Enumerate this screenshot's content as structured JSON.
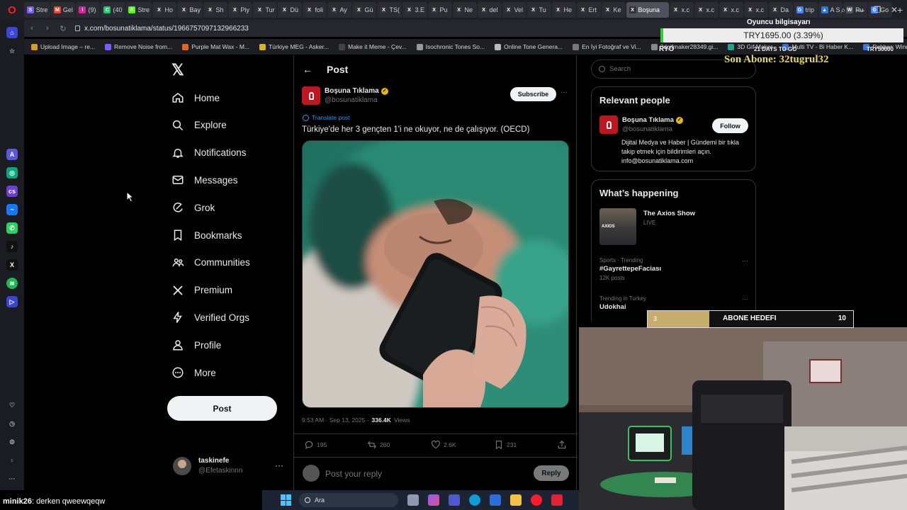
{
  "browser": {
    "tabs": [
      {
        "label": "Stre",
        "icon": "S",
        "color": "#7b5cff"
      },
      {
        "label": "Gel",
        "icon": "M",
        "color": "#ea4335"
      },
      {
        "label": "(9)",
        "icon": "I",
        "color": "#d6249f"
      },
      {
        "label": "(40",
        "icon": "C",
        "color": "#2fbf71"
      },
      {
        "label": "Stre",
        "icon": "K",
        "color": "#53fc18"
      },
      {
        "label": "Ho",
        "icon": "X",
        "color": "#333"
      },
      {
        "label": "Bay",
        "icon": "X",
        "color": "#333"
      },
      {
        "label": "Sh",
        "icon": "X",
        "color": "#333"
      },
      {
        "label": "Piy",
        "icon": "X",
        "color": "#333"
      },
      {
        "label": "Tur",
        "icon": "X",
        "color": "#333"
      },
      {
        "label": "Dü",
        "icon": "X",
        "color": "#333"
      },
      {
        "label": "foli",
        "icon": "X",
        "color": "#333"
      },
      {
        "label": "Ay",
        "icon": "X",
        "color": "#333"
      },
      {
        "label": "Gü",
        "icon": "X",
        "color": "#333"
      },
      {
        "label": "TS(",
        "icon": "X",
        "color": "#333"
      },
      {
        "label": "3.E",
        "icon": "X",
        "color": "#333"
      },
      {
        "label": "Pu",
        "icon": "X",
        "color": "#333"
      },
      {
        "label": "Ne",
        "icon": "X",
        "color": "#333"
      },
      {
        "label": "del",
        "icon": "X",
        "color": "#333"
      },
      {
        "label": "Vel",
        "icon": "X",
        "color": "#333"
      },
      {
        "label": "Tu",
        "icon": "X",
        "color": "#333"
      },
      {
        "label": "He",
        "icon": "X",
        "color": "#333"
      },
      {
        "label": "Ert",
        "icon": "X",
        "color": "#333"
      },
      {
        "label": "Ke",
        "icon": "X",
        "color": "#333"
      },
      {
        "label": "Boşuna",
        "icon": "X",
        "color": "#333",
        "active": true
      },
      {
        "label": "x.c",
        "icon": "X",
        "color": "#333"
      },
      {
        "label": "x.c",
        "icon": "X",
        "color": "#333"
      },
      {
        "label": "x.c",
        "icon": "X",
        "color": "#333"
      },
      {
        "label": "x.c",
        "icon": "X",
        "color": "#333"
      },
      {
        "label": "Da",
        "icon": "X",
        "color": "#333"
      },
      {
        "label": "trip",
        "icon": "G",
        "color": "#4285f4"
      },
      {
        "label": "A S",
        "icon": "▲",
        "color": "#2a7bd6"
      },
      {
        "label": "Ru",
        "icon": "W",
        "color": "#555"
      },
      {
        "label": "Go",
        "icon": "G",
        "color": "#4285f4"
      }
    ],
    "url": "x.com/bosunatiklama/status/1966757097132966233",
    "bookmarks": [
      "Upload Image – re...",
      "Remove Noise from...",
      "Purple Mat Wax - M...",
      "Türkiye MEG - Asker...",
      "Make it Meme - Çev...",
      "Isochronic Tones So...",
      "Online Tone Genera...",
      "En İyi Fotoğraf ve Vi...",
      "3dgifmaker28349.gi...",
      "3D Gif Maker",
      "Multi TV - Bi Haber K...",
      "Rehber: Windows 1..."
    ]
  },
  "x": {
    "logo": "𝕏",
    "nav": [
      {
        "label": "Home",
        "icon": "home-icon"
      },
      {
        "label": "Explore",
        "icon": "search-icon"
      },
      {
        "label": "Notifications",
        "icon": "bell-icon"
      },
      {
        "label": "Messages",
        "icon": "mail-icon"
      },
      {
        "label": "Grok",
        "icon": "grok-icon"
      },
      {
        "label": "Bookmarks",
        "icon": "bookmark-icon"
      },
      {
        "label": "Communities",
        "icon": "people-icon"
      },
      {
        "label": "Premium",
        "icon": "x-icon"
      },
      {
        "label": "Verified Orgs",
        "icon": "lightning-icon"
      },
      {
        "label": "Profile",
        "icon": "person-icon"
      },
      {
        "label": "More",
        "icon": "more-circle-icon"
      }
    ],
    "post_button": "Post",
    "account": {
      "name": "taskinefe",
      "handle": "@Efetaskinnn",
      "more": "···"
    },
    "post": {
      "header": "Post",
      "back": "←",
      "author": "Boşuna Tıklama",
      "handle": "@bosunatiklama",
      "subscribe": "Subscribe",
      "more": "···",
      "translate": "Translate post",
      "text": "Türkiye'de her 3 gençten 1'i ne okuyor, ne de çalışıyor. (OECD)",
      "timestamp": "9:53 AM · Sep 13, 2025 ·",
      "views": "336.4K",
      "views_label": "Views",
      "replies": "195",
      "reposts": "260",
      "likes": "2.6K",
      "bookmarks": "231",
      "reply_placeholder": "Post your reply",
      "reply_button": "Reply"
    },
    "right": {
      "search_placeholder": "Search",
      "relevant_title": "Relevant people",
      "relevant_name": "Boşuna Tıklama",
      "relevant_handle": "@bosunatiklama",
      "follow": "Follow",
      "relevant_bio": "Dijital Medya ve Haber | Gündemi bir tıkla takip etmek için bildirimleri açın. info@bosunatiklama.com",
      "happening_title": "What’s happening",
      "axios_thumb": "AXIOS",
      "axios_title": "The Axios Show",
      "axios_status": "LIVE",
      "trends": [
        {
          "context": "Sports · Trending",
          "name": "#GayrettepeFaciası",
          "count": "12K posts"
        },
        {
          "context": "Trending in Turkey",
          "name": "Udokhai",
          "count": ""
        }
      ]
    }
  },
  "overlay": {
    "pc_label": "Oyuncu bilgisayarı",
    "stock_value": "TRY1695.00 (3.39%)",
    "stock_low": "RYO",
    "stock_days": "21 DAYS TO GO",
    "stock_high": "TRY50000",
    "last_sub": "Son Abone: 32tugrul32",
    "goal_current": "3",
    "goal_label": "ABONE HEDEFI",
    "goal_target": "10",
    "goal_progress": 0.3,
    "chat_user": "minik26",
    "chat_text": ": derken qweewqeqw"
  },
  "taskbar": {
    "search": "Ara"
  },
  "colors": {
    "x_bg": "#000000",
    "x_text": "#e7e9ea",
    "x_muted": "#71767b",
    "x_accent": "#1d9bf0",
    "verified_gold": "#e2b719",
    "brand_red": "#c0161f"
  }
}
